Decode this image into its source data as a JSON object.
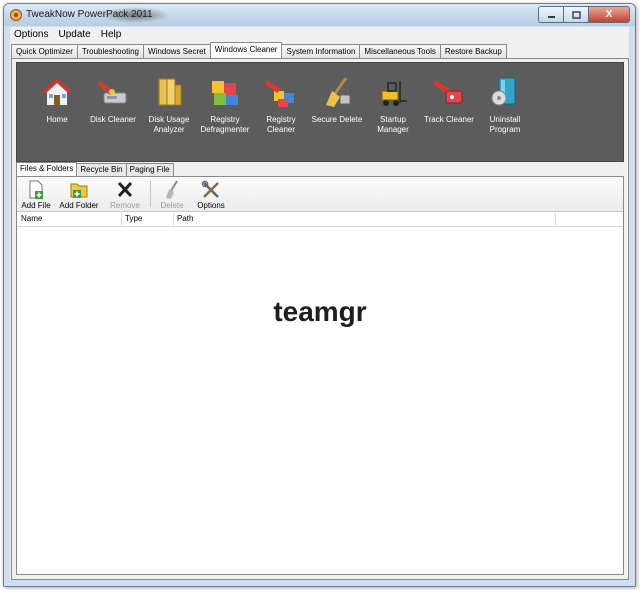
{
  "window": {
    "title": "TweakNow PowerPack 2011",
    "icons": {
      "app": "app-icon",
      "minimize": "minimize-icon",
      "maximize": "maximize-icon",
      "close": "close-icon"
    },
    "close_glyph": "X"
  },
  "menu": [
    "Options",
    "Update",
    "Help"
  ],
  "top_tabs": [
    "Quick Optimizer",
    "Troubleshooting",
    "Windows Secret",
    "Windows Cleaner",
    "System Information",
    "Miscellaneous Tools",
    "Restore Backup"
  ],
  "active_top_tab": "Windows Cleaner",
  "tools": [
    {
      "label": "Home",
      "icon": "home-icon"
    },
    {
      "label": "Disk Cleaner",
      "icon": "disk-cleaner-icon"
    },
    {
      "label": "Disk Usage Analyzer",
      "icon": "disk-usage-icon"
    },
    {
      "label": "Registry Defragmenter",
      "icon": "registry-defrag-icon"
    },
    {
      "label": "Registry Cleaner",
      "icon": "registry-cleaner-icon"
    },
    {
      "label": "Secure Delete",
      "icon": "secure-delete-icon"
    },
    {
      "label": "Startup Manager",
      "icon": "startup-manager-icon"
    },
    {
      "label": "Track Cleaner",
      "icon": "track-cleaner-icon"
    },
    {
      "label": "Uninstall Program",
      "icon": "uninstall-icon"
    }
  ],
  "sub_tabs": [
    "Files & Folders",
    "Recycle Bin",
    "Paging File"
  ],
  "active_sub_tab": "Files & Folders",
  "actions": {
    "add_file": "Add File",
    "add_folder": "Add Folder",
    "remove": "Remove",
    "delete": "Delete",
    "options": "Options"
  },
  "columns": [
    "Name",
    "Type",
    "Path"
  ],
  "overlay_text": "teamgr",
  "colors": {
    "toolstrip": "#5c5c5c",
    "title_bar": "#c4d6ea",
    "close_button": "#c4432b"
  }
}
